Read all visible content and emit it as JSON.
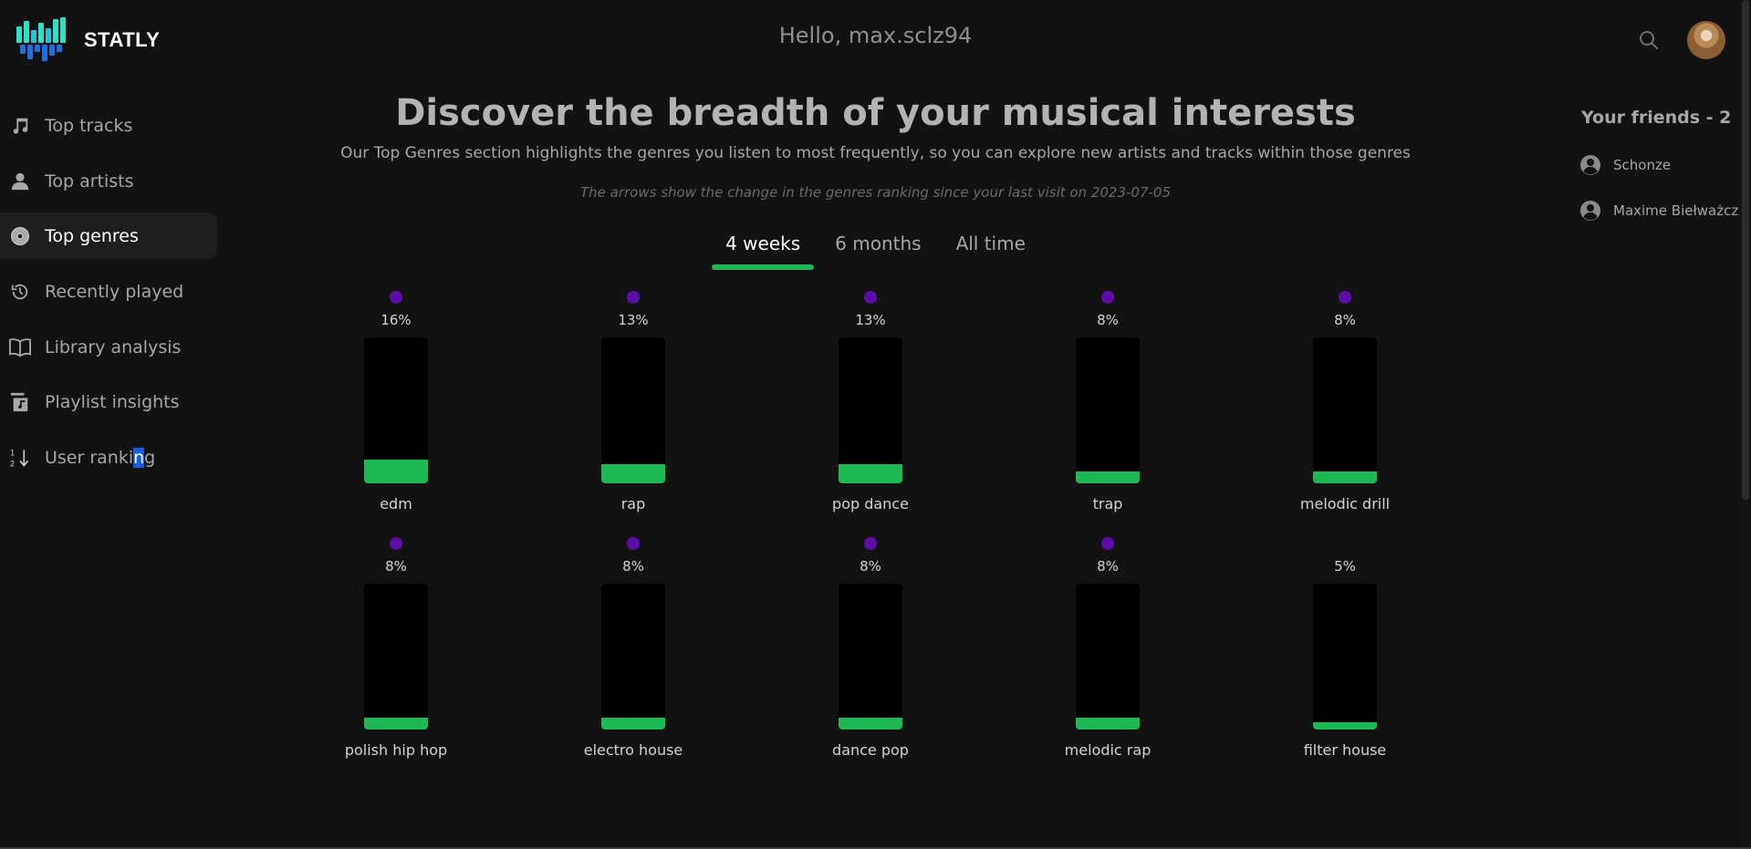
{
  "app": {
    "brand": "STATLY"
  },
  "header": {
    "greeting": "Hello, max.sclz94"
  },
  "sidebar": {
    "items": [
      {
        "label": "Top tracks",
        "icon": "music-note-icon",
        "active": false
      },
      {
        "label": "Top artists",
        "icon": "person-icon",
        "active": false
      },
      {
        "label": "Top genres",
        "icon": "vinyl-icon",
        "active": true
      },
      {
        "label": "Recently played",
        "icon": "history-icon",
        "active": false
      },
      {
        "label": "Library analysis",
        "icon": "book-icon",
        "active": false
      },
      {
        "label": "Playlist insights",
        "icon": "playlist-icon",
        "active": false
      },
      {
        "label_start": "User ranki",
        "label_highlight": "n",
        "label_end": "g",
        "icon": "sort-numeric-icon",
        "active": false
      }
    ]
  },
  "main": {
    "headline": "Discover the breadth of your musical interests",
    "subline": "Our Top Genres section highlights the genres you listen to most frequently, so you can explore new artists and tracks within those genres",
    "note": "The arrows show the change in the genres ranking since your last visit on 2023-07-05",
    "tabs": [
      {
        "label": "4 weeks",
        "active": true
      },
      {
        "label": "6 months",
        "active": false
      },
      {
        "label": "All time",
        "active": false
      }
    ],
    "genres": [
      {
        "name": "edm",
        "percent": "16%",
        "fill": 0.16,
        "indicator": true
      },
      {
        "name": "rap",
        "percent": "13%",
        "fill": 0.13,
        "indicator": true
      },
      {
        "name": "pop dance",
        "percent": "13%",
        "fill": 0.13,
        "indicator": true
      },
      {
        "name": "trap",
        "percent": "8%",
        "fill": 0.08,
        "indicator": true
      },
      {
        "name": "melodic drill",
        "percent": "8%",
        "fill": 0.08,
        "indicator": true
      },
      {
        "name": "polish hip hop",
        "percent": "8%",
        "fill": 0.08,
        "indicator": true
      },
      {
        "name": "electro house",
        "percent": "8%",
        "fill": 0.08,
        "indicator": true
      },
      {
        "name": "dance pop",
        "percent": "8%",
        "fill": 0.08,
        "indicator": true
      },
      {
        "name": "melodic rap",
        "percent": "8%",
        "fill": 0.08,
        "indicator": true
      },
      {
        "name": "filter house",
        "percent": "5%",
        "fill": 0.05,
        "indicator": false
      }
    ]
  },
  "friends": {
    "title": "Your friends - 2",
    "items": [
      {
        "name": "Schonze"
      },
      {
        "name": "Maxime Biełważcz..."
      }
    ]
  },
  "colors": {
    "background": "#121212",
    "accent": "#1db954",
    "indicator": "#5e0ea8",
    "bar_track": "#000000"
  }
}
